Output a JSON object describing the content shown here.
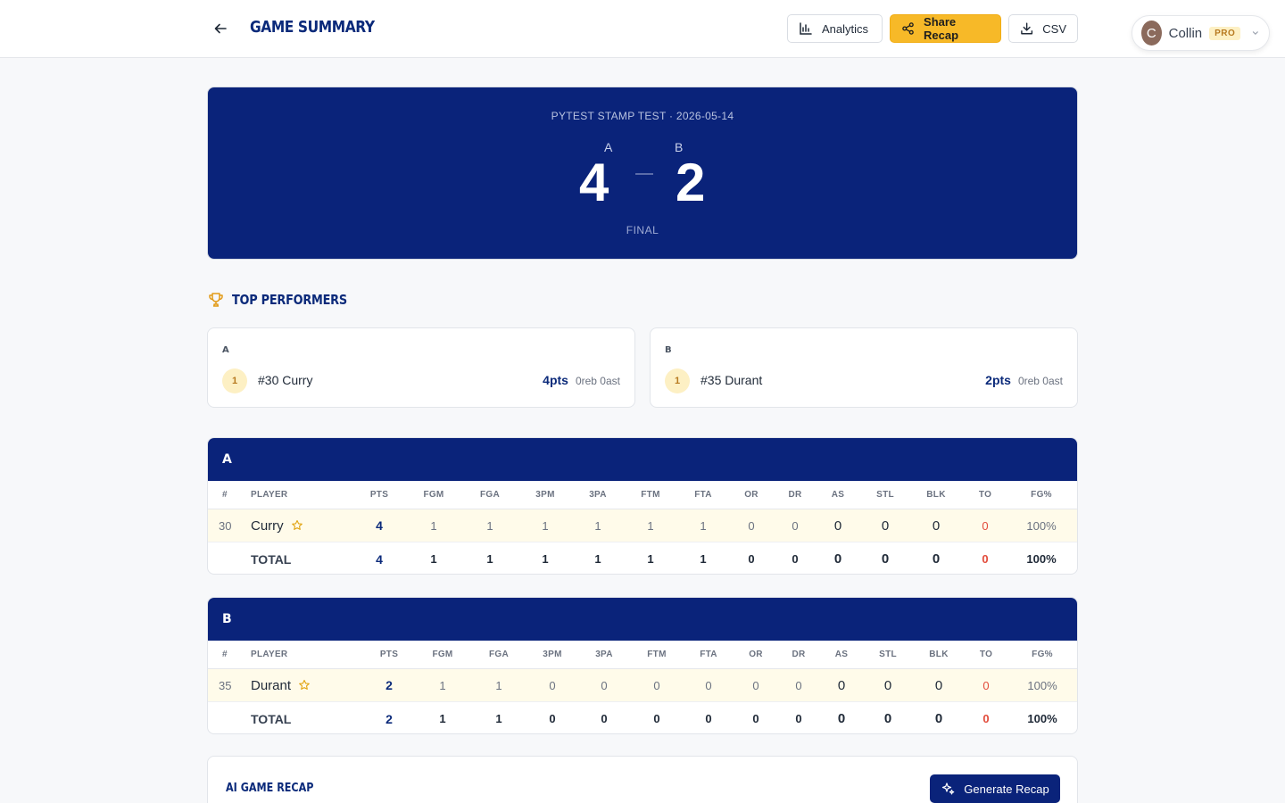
{
  "header": {
    "title": "GAME SUMMARY",
    "analytics_label": "Analytics",
    "share_label": "Share Recap",
    "csv_label": "CSV",
    "user": {
      "initial": "C",
      "name": "Collin",
      "badge": "PRO"
    }
  },
  "scoreboard": {
    "meta": "PYTEST STAMP TEST · 2026-05-14",
    "home": {
      "team": "A",
      "score": "4"
    },
    "away": {
      "team": "B",
      "score": "2"
    },
    "status": "FINAL"
  },
  "top_performers": {
    "title": "TOP PERFORMERS",
    "cards": [
      {
        "team": "A",
        "rank": "1",
        "player": "#30 Curry",
        "pts": "4pts",
        "extra": "0reb 0ast"
      },
      {
        "team": "B",
        "rank": "1",
        "player": "#35 Durant",
        "pts": "2pts",
        "extra": "0reb 0ast"
      }
    ]
  },
  "box_scores": {
    "columns": [
      "#",
      "PLAYER",
      "PTS",
      "FGM",
      "FGA",
      "3PM",
      "3PA",
      "FTM",
      "FTA",
      "OR",
      "DR",
      "AS",
      "STL",
      "BLK",
      "TO",
      "FG%"
    ],
    "teams": [
      {
        "name": "A",
        "player": [
          "30",
          "Curry",
          "4",
          "1",
          "1",
          "1",
          "1",
          "1",
          "1",
          "0",
          "0",
          "0",
          "0",
          "0",
          "0",
          "100%"
        ],
        "total": [
          "",
          "TOTAL",
          "4",
          "1",
          "1",
          "1",
          "1",
          "1",
          "1",
          "0",
          "0",
          "0",
          "0",
          "0",
          "0",
          "100%"
        ]
      },
      {
        "name": "B",
        "player": [
          "35",
          "Durant",
          "2",
          "1",
          "1",
          "0",
          "0",
          "0",
          "0",
          "0",
          "0",
          "0",
          "0",
          "0",
          "0",
          "100%"
        ],
        "total": [
          "",
          "TOTAL",
          "2",
          "1",
          "1",
          "0",
          "0",
          "0",
          "0",
          "0",
          "0",
          "0",
          "0",
          "0",
          "0",
          "100%"
        ]
      }
    ]
  },
  "recap": {
    "title": "AI GAME RECAP",
    "button_label": "Generate Recap"
  }
}
